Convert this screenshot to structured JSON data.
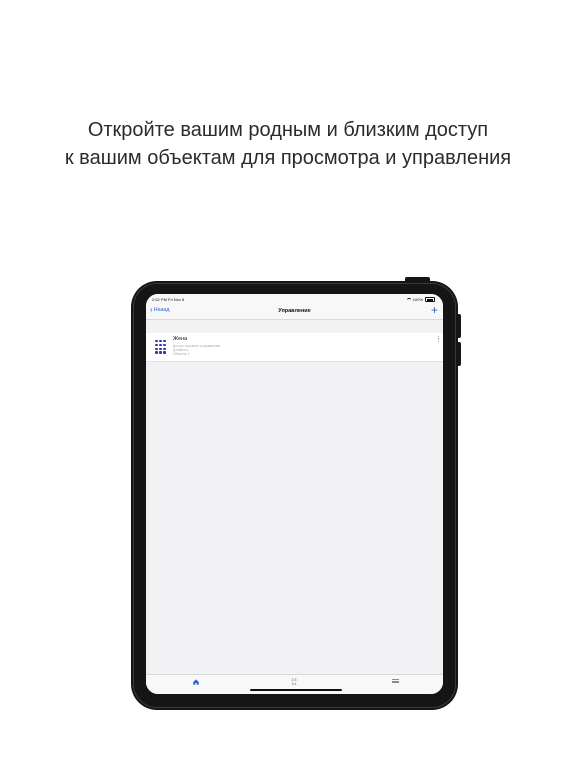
{
  "headline": {
    "line1": "Откройте вашим родным и близким доступ",
    "line2": "к вашим объектам для просмотра и управления"
  },
  "device": {
    "status_bar": {
      "time_carrier": "2:52 PM   Fri Nov 8",
      "battery": "100%"
    },
    "nav": {
      "back_label": "Назад",
      "title": "Управление",
      "add_icon": "plus-icon"
    },
    "list": {
      "items": [
        {
          "icon": "keypad-icon",
          "title": "Жена",
          "line1": "Доступ: просмотр и управление",
          "line2": "Добавлен: ...",
          "line3": "Объекты: 1"
        }
      ]
    },
    "tab_bar": {
      "home_icon": "home-icon",
      "middle_line1": "2:3",
      "middle_line2": "4:1",
      "menu_icon": "menu-icon"
    },
    "colors": {
      "accent": "#2d63c8",
      "keypad": "#2a3aa0",
      "frame": "#151515"
    }
  }
}
